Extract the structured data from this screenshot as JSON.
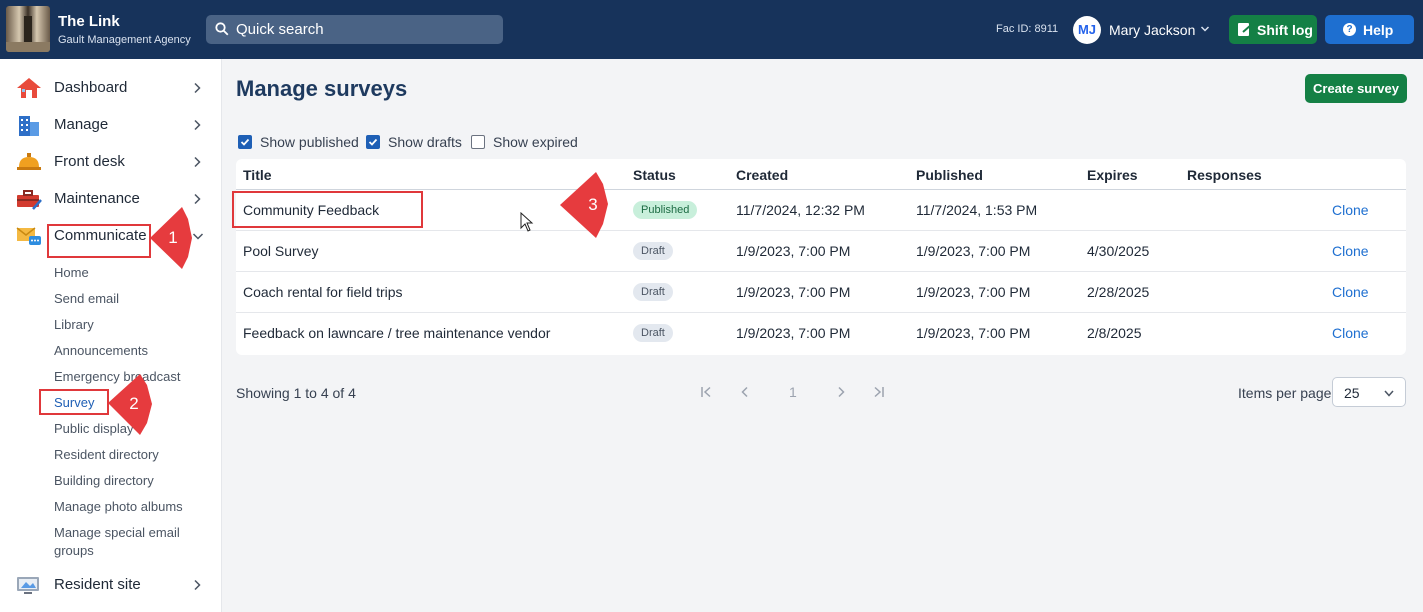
{
  "header": {
    "app_title": "The Link",
    "app_subtitle": "Gault Management Agency",
    "search_placeholder": "Quick search",
    "fac_id": "Fac ID: 8911",
    "user_initials": "MJ",
    "user_name": "Mary Jackson",
    "shift_log_label": "Shift log",
    "help_label": "Help"
  },
  "sidebar": {
    "items": [
      {
        "label": "Dashboard",
        "icon": "house-icon"
      },
      {
        "label": "Manage",
        "icon": "building-icon"
      },
      {
        "label": "Front desk",
        "icon": "bell-icon"
      },
      {
        "label": "Maintenance",
        "icon": "toolbox-icon"
      },
      {
        "label": "Communicate",
        "icon": "mail-chat-icon"
      }
    ],
    "communicate_sub": [
      "Home",
      "Send email",
      "Library",
      "Announcements",
      "Emergency broadcast",
      "Survey",
      "Public display",
      "Resident directory",
      "Building directory",
      "Manage photo albums",
      "Manage special email",
      "groups"
    ],
    "resident_site_label": "Resident site"
  },
  "main": {
    "title": "Manage surveys",
    "create_label": "Create survey",
    "filters": [
      {
        "label": "Show published",
        "checked": true
      },
      {
        "label": "Show drafts",
        "checked": true
      },
      {
        "label": "Show expired",
        "checked": false
      }
    ],
    "table": {
      "columns": [
        "Title",
        "Status",
        "Created",
        "Published",
        "Expires",
        "Responses"
      ],
      "rows": [
        {
          "title": "Community Feedback",
          "status": "Published",
          "created": "11/7/2024, 12:32 PM",
          "published": "11/7/2024, 1:53 PM",
          "expires": "",
          "responses": "",
          "action": "Clone"
        },
        {
          "title": "Pool Survey",
          "status": "Draft",
          "created": "1/9/2023, 7:00 PM",
          "published": "1/9/2023, 7:00 PM",
          "expires": "4/30/2025",
          "responses": "",
          "action": "Clone"
        },
        {
          "title": "Coach rental for field trips",
          "status": "Draft",
          "created": "1/9/2023, 7:00 PM",
          "published": "1/9/2023, 7:00 PM",
          "expires": "2/28/2025",
          "responses": "",
          "action": "Clone"
        },
        {
          "title": "Feedback on lawncare / tree maintenance vendor",
          "status": "Draft",
          "created": "1/9/2023, 7:00 PM",
          "published": "1/9/2023, 7:00 PM",
          "expires": "2/8/2025",
          "responses": "",
          "action": "Clone"
        }
      ]
    },
    "pagination": {
      "showing": "Showing 1 to 4 of 4",
      "current_page": "1",
      "items_per_page_label": "Items per page",
      "items_per_page": "25"
    }
  },
  "annotations": {
    "step1": "1",
    "step2": "2",
    "step3": "3"
  },
  "colors": {
    "topbar": "#17335b",
    "accent_green": "#148045",
    "accent_blue": "#1e6fd0",
    "annotation_red": "#e0383b"
  }
}
